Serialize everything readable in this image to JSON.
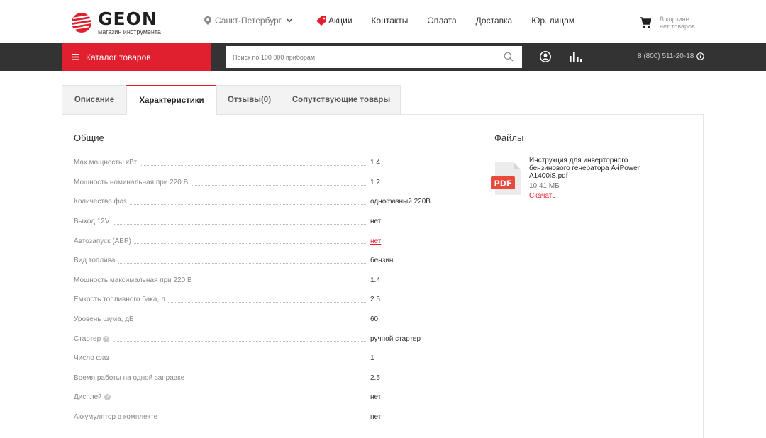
{
  "header": {
    "logo_name": "GEON",
    "logo_sub": "магазин инструмента",
    "city": "Санкт-Петербург",
    "nav": [
      "Акции",
      "Контакты",
      "Оплата",
      "Доставка",
      "Юр. лицам"
    ],
    "cart_line1": "В корзине",
    "cart_line2": "нет товаров"
  },
  "toolbar": {
    "catalog_label": "Каталог товаров",
    "search_placeholder": "Поиск по 100 000 приборам",
    "phone": "8 (800) 511-20-18"
  },
  "tabs": [
    {
      "label": "Описание",
      "active": false
    },
    {
      "label": "Характеристики",
      "active": true
    },
    {
      "label": "Отзывы(0)",
      "active": false
    },
    {
      "label": "Сопутствующие товары",
      "active": false
    }
  ],
  "specs_title": "Общие",
  "specs": [
    {
      "name": "Max мощность, кВт",
      "value": "1.4"
    },
    {
      "name": "Мощность номинальная при 220 В",
      "value": "1.2"
    },
    {
      "name": "Количество фаз",
      "value": "однофазный 220В"
    },
    {
      "name": "Выход 12V",
      "value": "нет"
    },
    {
      "name": "Автозапуск (АВР)",
      "value": "нет"
    },
    {
      "name": "Вид топлива",
      "value": "бензин"
    },
    {
      "name": "Мощность максимальная при 220 В",
      "value": "1.4"
    },
    {
      "name": "Емкость топливного бака, л",
      "value": "2.5"
    },
    {
      "name": "Уровень шума, дБ",
      "value": "60"
    },
    {
      "name": "Стартер",
      "value": "ручной стартер"
    },
    {
      "name": "Число фаз",
      "value": "1"
    },
    {
      "name": "Время работы на одной заправке",
      "value": "2.5"
    },
    {
      "name": "Дисплей",
      "value": "нет"
    },
    {
      "name": "Аккумулятор в комплекте",
      "value": "нет"
    }
  ],
  "files_title": "Файлы",
  "file": {
    "name": "Инструкция для инверторного бензинового генератора A-iPower A1400iS.pdf",
    "size": "10.41 МБ",
    "download": "Скачать",
    "badge": "PDF"
  },
  "colors": {
    "accent": "#e01f2f",
    "dark_bar": "#333333"
  }
}
